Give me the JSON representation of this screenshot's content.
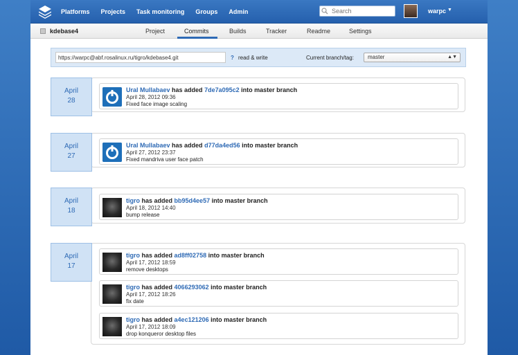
{
  "nav": {
    "items": [
      "Platforms",
      "Projects",
      "Task monitoring",
      "Groups",
      "Admin"
    ],
    "search_placeholder": "Search",
    "user": "warpc"
  },
  "project": {
    "name": "kdebase4",
    "tabs": [
      "Project",
      "Commits",
      "Builds",
      "Tracker",
      "Readme",
      "Settings"
    ],
    "active_tab": "Commits"
  },
  "repo": {
    "url": "https://warpc@abf.rosalinux.ru/tigro/kdebase4.git",
    "help": "?",
    "access": "read & write",
    "branch_label": "Current branch/tag:",
    "branch": "master"
  },
  "days": [
    {
      "month": "April",
      "day": "28",
      "commits": [
        {
          "author": "Ural Mullabaev",
          "action": "has added",
          "hash": "7de7a095c2",
          "suffix": "into master branch",
          "date": "April 28, 2012 09:36",
          "message": "Fixed face image scaling",
          "avatar": "logo"
        }
      ]
    },
    {
      "month": "April",
      "day": "27",
      "commits": [
        {
          "author": "Ural Mullabaev",
          "action": "has added",
          "hash": "d77da4ed56",
          "suffix": "into master branch",
          "date": "April 27, 2012 23:37",
          "message": "Fixed mandriva user face patch",
          "avatar": "logo"
        }
      ]
    },
    {
      "month": "April",
      "day": "18",
      "commits": [
        {
          "author": "tigro",
          "action": "has added",
          "hash": "bb95d4ee57",
          "suffix": "into master branch",
          "date": "April 18, 2012 14:40",
          "message": "bump release",
          "avatar": "photo"
        }
      ]
    },
    {
      "month": "April",
      "day": "17",
      "commits": [
        {
          "author": "tigro",
          "action": "has added",
          "hash": "ad8ff02758",
          "suffix": "into master branch",
          "date": "April 17, 2012 18:59",
          "message": "remove desktops",
          "avatar": "photo"
        },
        {
          "author": "tigro",
          "action": "has added",
          "hash": "4066293062",
          "suffix": "into master branch",
          "date": "April 17, 2012 18:26",
          "message": "fix date",
          "avatar": "photo"
        },
        {
          "author": "tigro",
          "action": "has added",
          "hash": "a4ec121206",
          "suffix": "into master branch",
          "date": "April 17, 2012 18:09",
          "message": "drop konqueror desktop files",
          "avatar": "photo"
        }
      ]
    }
  ]
}
